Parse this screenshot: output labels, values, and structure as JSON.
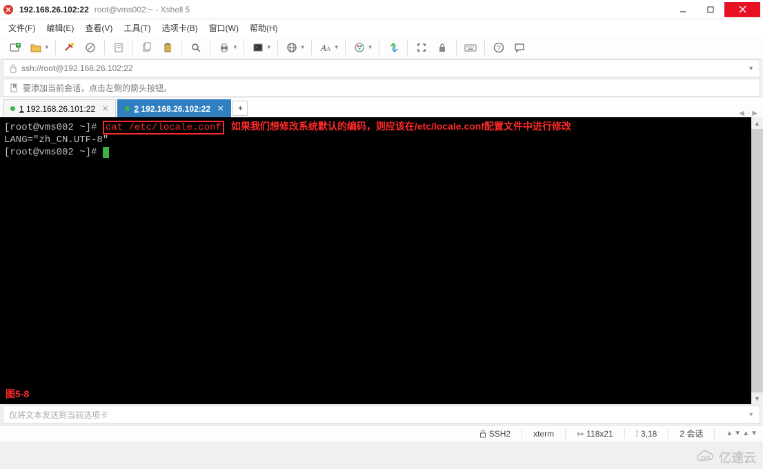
{
  "titlebar": {
    "title": "192.168.26.102:22",
    "subtitle": "root@vms002:~ - Xshell 5"
  },
  "menubar": {
    "items": [
      "文件(F)",
      "编辑(E)",
      "查看(V)",
      "工具(T)",
      "选项卡(B)",
      "窗口(W)",
      "帮助(H)"
    ]
  },
  "addressbar": {
    "url": "ssh://root@192.168.26.102:22"
  },
  "hintbar": {
    "text": "要添加当前会话，点击左侧的箭头按钮。"
  },
  "tabs": {
    "items": [
      {
        "num": "1",
        "label": "192.168.26.101:22",
        "active": false
      },
      {
        "num": "2",
        "label": "192.168.26.102:22",
        "active": true
      }
    ]
  },
  "terminal": {
    "line1_prompt": "[root@vms002 ~]# ",
    "line1_command": "cat /etc/locale.conf",
    "line1_annotation": "如果我们想修改系统默认的编码，则应该在/etc/locale.conf配置文件中进行修改",
    "line2_output": "LANG=\"zh_CN.UTF-8\"",
    "line3_prompt": "[root@vms002 ~]# ",
    "figure_label": "图5-8"
  },
  "sendbar": {
    "placeholder": "仅将文本发送到当前选项卡"
  },
  "statusbar": {
    "protocol": "SSH2",
    "term": "xterm",
    "size": "118x21",
    "cursor": "3,18",
    "sessions": "2 会话"
  },
  "watermark": {
    "text": "亿速云"
  }
}
